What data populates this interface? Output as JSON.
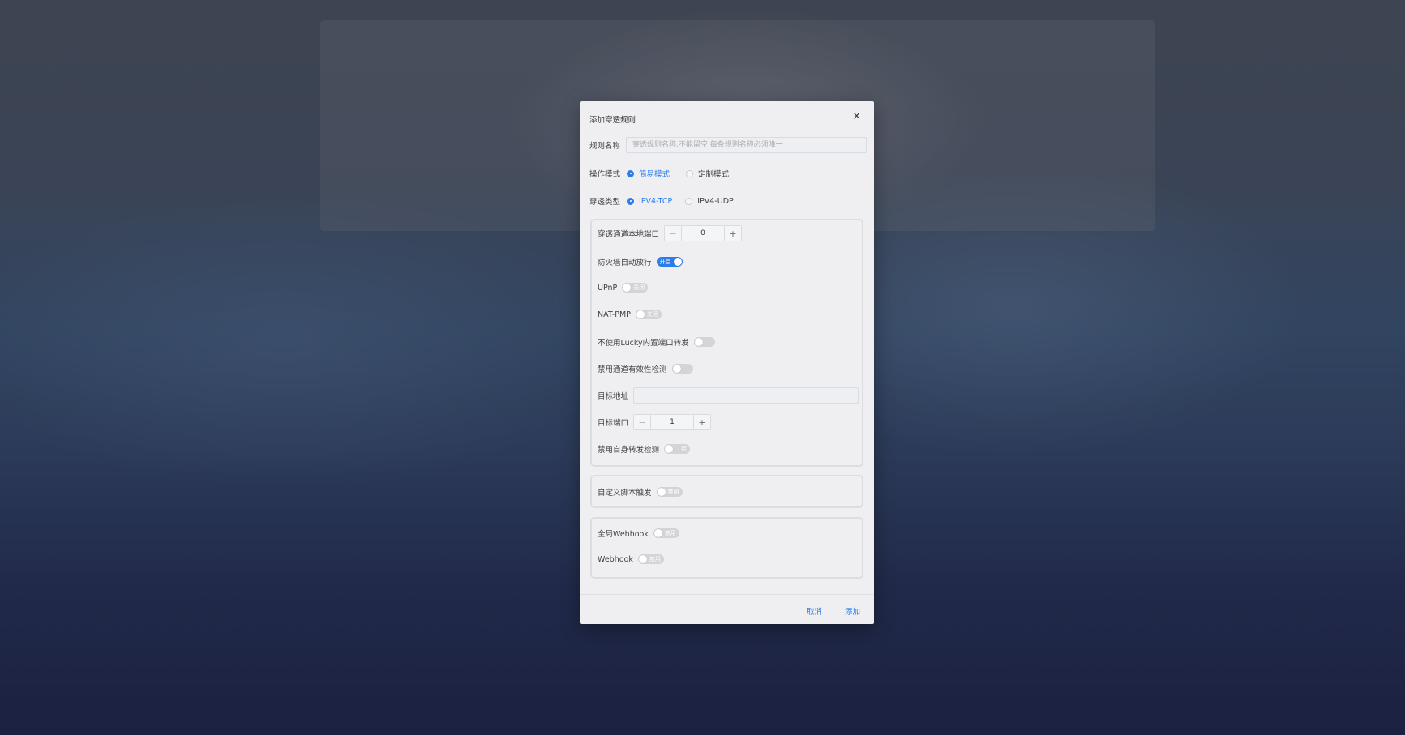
{
  "dialog": {
    "title": "添加穿透规则",
    "close_label": "×",
    "rule_name": {
      "label": "规则名称",
      "placeholder": "穿透规则名称,不能留空,每条规则名称必须唯一",
      "value": ""
    },
    "mode": {
      "label": "操作模式",
      "options": [
        "简易模式",
        "定制模式"
      ],
      "selected": "简易模式"
    },
    "type": {
      "label": "穿透类型",
      "options": [
        "IPV4-TCP",
        "IPV4-UDP"
      ],
      "selected": "IPV4-TCP"
    },
    "tunnel": {
      "local_port": {
        "label": "穿透通道本地端口",
        "value": "0",
        "minus": "−",
        "plus": "+"
      },
      "firewall": {
        "label": "防火墙自动放行",
        "switch_text": "开启",
        "on": true
      },
      "upnp": {
        "label": "UPnP",
        "switch_text": "关闭",
        "on": false
      },
      "natpmp": {
        "label": "NAT-PMP",
        "switch_text": "关闭",
        "on": false
      },
      "no_lucky_forward": {
        "label": "不使用Lucky内置端口转发",
        "switch_text": "",
        "on": false
      },
      "disable_tunnel_check": {
        "label": "禁用通道有效性检测",
        "switch_text": "",
        "on": false
      },
      "target_address": {
        "label": "目标地址",
        "value": ""
      },
      "target_port": {
        "label": "目标端口",
        "value": "1",
        "minus": "−",
        "plus": "+"
      },
      "disable_self_forward_check": {
        "label": "禁用自身转发检测",
        "switch_text": "否",
        "on": false
      }
    },
    "script": {
      "label": "自定义脚本触发",
      "switch_text": "禁用",
      "on": false
    },
    "webhooks": {
      "global": {
        "label": "全局Wehhook",
        "switch_text": "禁用",
        "on": false
      },
      "webhook": {
        "label": "Webhook",
        "switch_text": "禁用",
        "on": false
      }
    },
    "footer": {
      "cancel": "取消",
      "add": "添加"
    },
    "accent_color": "#2d7de9"
  }
}
